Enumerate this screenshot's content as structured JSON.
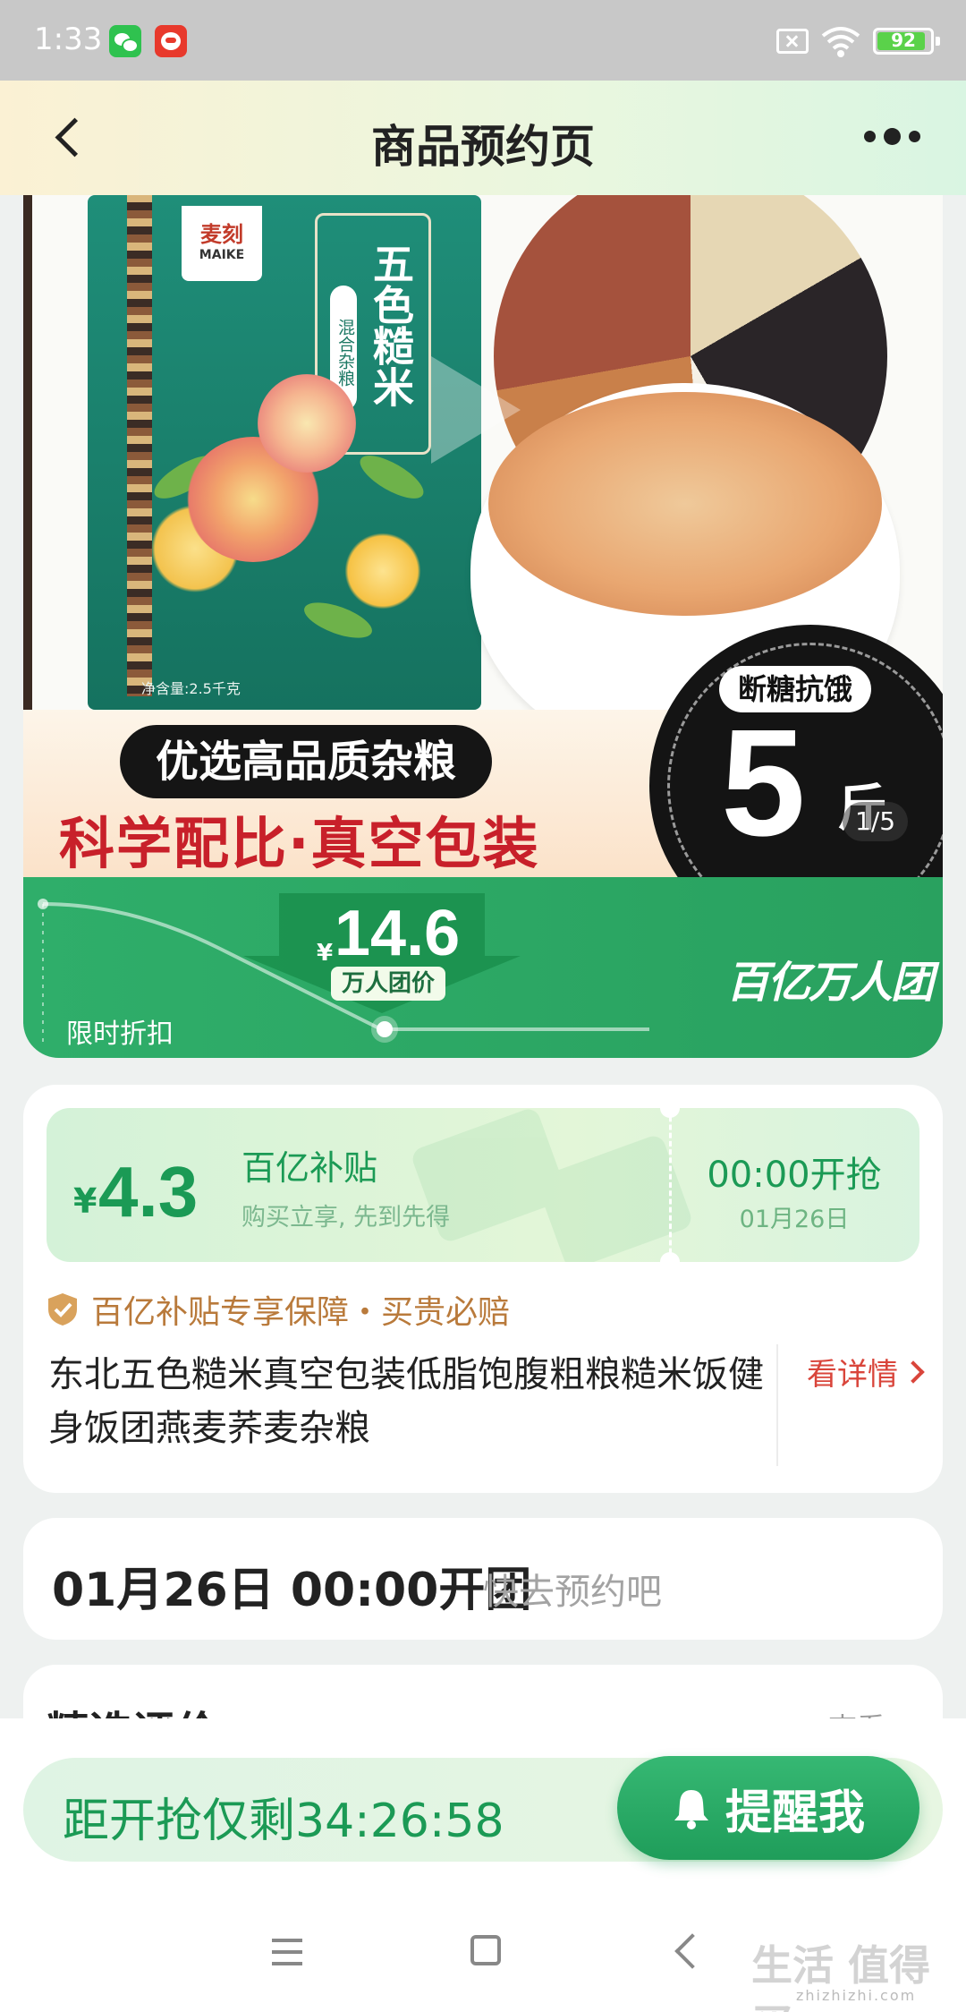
{
  "status_bar": {
    "time": "1:33",
    "battery": "92",
    "battery_level": 0.92
  },
  "header": {
    "title": "商品预约页"
  },
  "hero": {
    "brand_cn": "麦刻",
    "brand_en": "MAIKE",
    "package_title": "五色糙米",
    "package_sub": "混合杂粮",
    "net_weight": "净含量:2.5千克",
    "badge_pill": "断糖抗饿",
    "badge_number": "5",
    "badge_unit": "斤",
    "tagline_dark": "优选高品质杂粮",
    "tagline_red": "科学配比·真空包装",
    "slide_indicator": "1/5"
  },
  "price_band": {
    "currency": "¥",
    "price": "14.6",
    "price_tag": "万人团价",
    "limited_label": "限时折扣",
    "campaign_logo": "百亿万人团"
  },
  "subsidy": {
    "currency": "¥",
    "amount": "4.3",
    "title": "百亿补贴",
    "desc": "购买立享, 先到先得",
    "start_time": "00:00开抢",
    "start_date": "01月26日",
    "guarantee": "百亿补贴专享保障・买贵必赔",
    "product_name": "东北五色糙米真空包装低脂饱腹粗粮糙米饭健身饭团燕麦荞麦杂粮",
    "detail_link": "看详情"
  },
  "open_card": {
    "time": "01月26日 00:00开团",
    "hint": "快去预约吧"
  },
  "reviews": {
    "title": "精选评价",
    "more": "查看"
  },
  "bottom_bar": {
    "countdown": "距开抢仅剩34:26:58",
    "remind_label": "提醒我"
  },
  "watermark": {
    "text": "生活 值得买",
    "sub": "zhizhizhi.com"
  },
  "colors": {
    "brand_green": "#1b9a55",
    "accent_red": "#c8202a",
    "guarantee_gold": "#b97a3b"
  },
  "icons": [
    "wechat-icon",
    "app-icon",
    "sim-icon",
    "wifi-icon",
    "battery-icon",
    "back-icon",
    "more-icon",
    "play-icon",
    "shield-icon",
    "chevron-right-icon",
    "bell-icon",
    "nav-menu-icon",
    "nav-home-icon",
    "nav-back-icon"
  ]
}
